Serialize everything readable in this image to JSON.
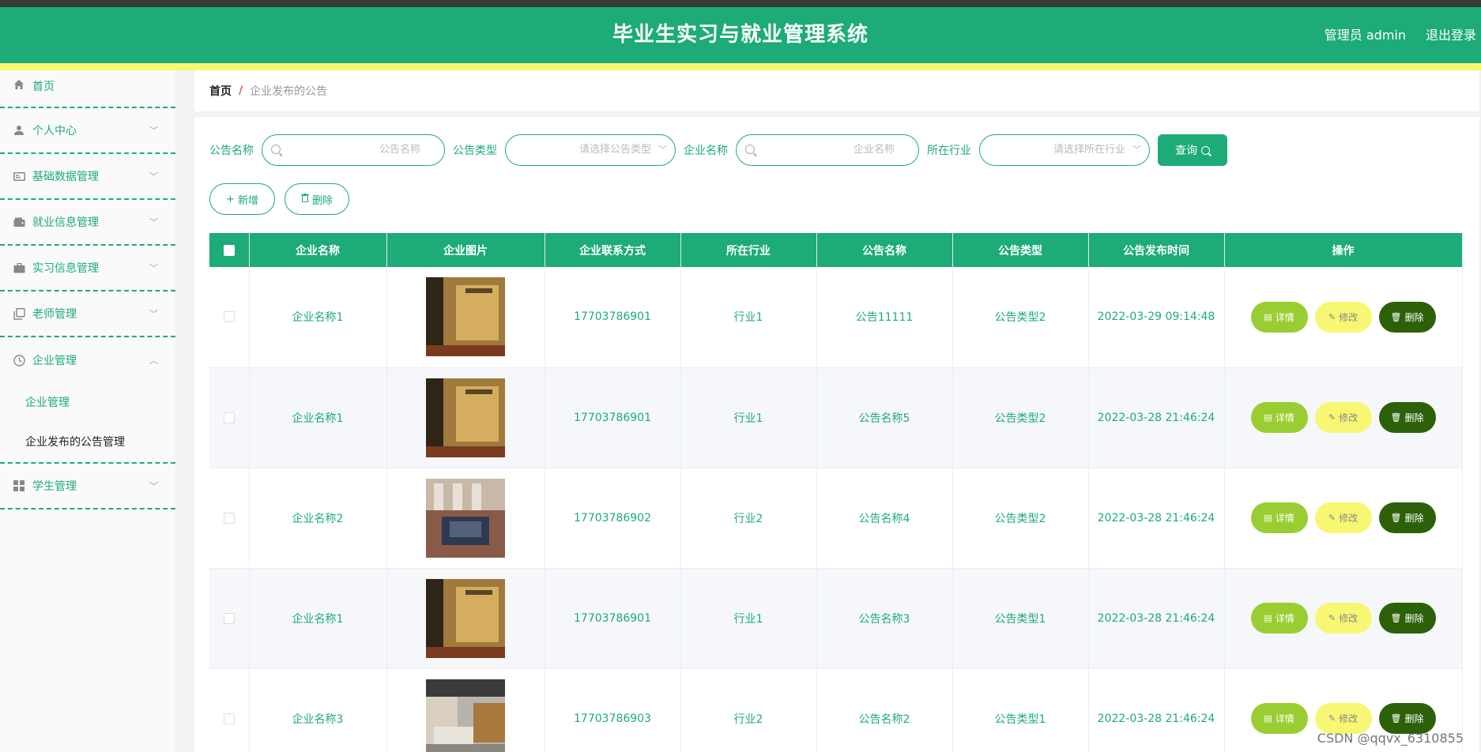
{
  "header": {
    "title": "毕业生实习与就业管理系统",
    "user": "管理员 admin",
    "logout": "退出登录"
  },
  "sidebar": {
    "items": [
      {
        "label": "首页",
        "icon": "home-icon"
      },
      {
        "label": "个人中心",
        "icon": "user-icon"
      },
      {
        "label": "基础数据管理",
        "icon": "id-card-icon"
      },
      {
        "label": "就业信息管理",
        "icon": "wallet-icon"
      },
      {
        "label": "实习信息管理",
        "icon": "briefcase-icon"
      },
      {
        "label": "老师管理",
        "icon": "copy-icon"
      },
      {
        "label": "企业管理",
        "icon": "clock-icon"
      },
      {
        "label": "学生管理",
        "icon": "grid-icon"
      }
    ],
    "subitems": [
      {
        "label": "企业管理"
      },
      {
        "label": "企业发布的公告管理"
      }
    ]
  },
  "breadcrumb": {
    "home": "首页",
    "sep": "/",
    "current": "企业发布的公告"
  },
  "search": {
    "name_label": "公告名称",
    "name_placeholder": "公告名称",
    "type_label": "公告类型",
    "type_placeholder": "请选择公告类型",
    "company_label": "企业名称",
    "company_placeholder": "企业名称",
    "industry_label": "所在行业",
    "industry_placeholder": "请选择所在行业",
    "query_button": "查询"
  },
  "actions": {
    "add": "新增",
    "delete": "删除"
  },
  "table": {
    "headers": [
      "企业名称",
      "企业图片",
      "企业联系方式",
      "所在行业",
      "公告名称",
      "公告类型",
      "公告发布时间",
      "操作"
    ],
    "rows": [
      {
        "company": "企业名称1",
        "phone": "17703786901",
        "industry": "行业1",
        "notice": "公告11111",
        "type": "公告类型2",
        "time": "2022-03-29 09:14:48"
      },
      {
        "company": "企业名称1",
        "phone": "17703786901",
        "industry": "行业1",
        "notice": "公告名称5",
        "type": "公告类型2",
        "time": "2022-03-28 21:46:24"
      },
      {
        "company": "企业名称2",
        "phone": "17703786902",
        "industry": "行业2",
        "notice": "公告名称4",
        "type": "公告类型2",
        "time": "2022-03-28 21:46:24"
      },
      {
        "company": "企业名称1",
        "phone": "17703786901",
        "industry": "行业1",
        "notice": "公告名称3",
        "type": "公告类型1",
        "time": "2022-03-28 21:46:24"
      },
      {
        "company": "企业名称3",
        "phone": "17703786903",
        "industry": "行业2",
        "notice": "公告名称2",
        "type": "公告类型1",
        "time": "2022-03-28 21:46:24"
      }
    ],
    "op_detail": "详情",
    "op_edit": "修改",
    "op_delete": "删除"
  },
  "watermark": "CSDN @qqvx_6310855",
  "colors": {
    "primary": "#1dab78",
    "accent_yellow": "#f7f774",
    "detail": "#9acd32",
    "delete": "#2d6109"
  }
}
